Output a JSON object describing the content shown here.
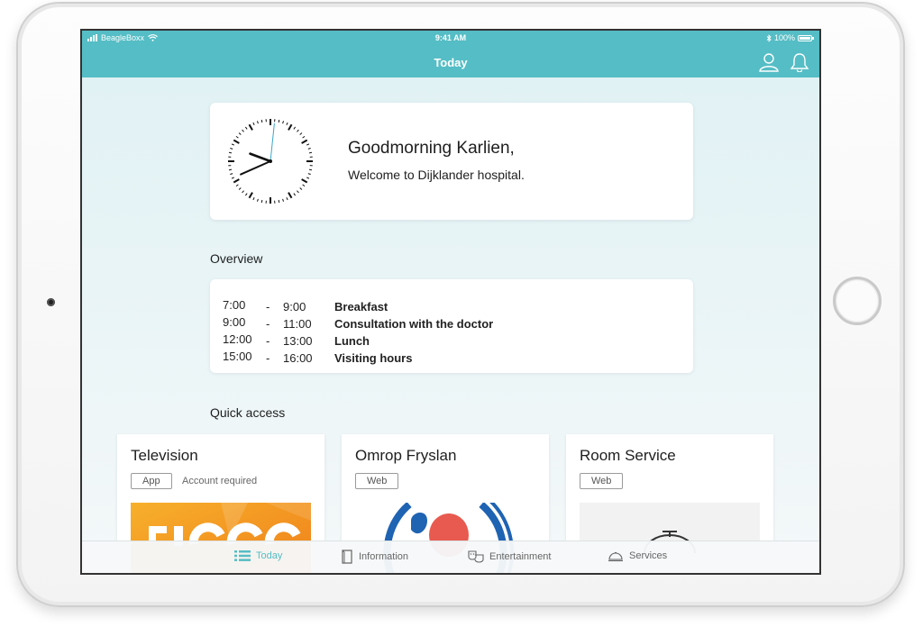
{
  "status_bar": {
    "carrier": "BeagleBoxx",
    "time": "9:41 AM",
    "bluetooth_icon": "bluetooth-icon",
    "battery": "100%"
  },
  "header": {
    "title": "Today",
    "icons": [
      "user-icon",
      "bell-icon"
    ]
  },
  "welcome": {
    "greeting": "Goodmorning Karlien,",
    "message": "Welcome to Dijklander hospital.",
    "clock": {
      "hour": 9,
      "minute": 41,
      "second": 1
    }
  },
  "overview": {
    "title": "Overview",
    "schedule": [
      {
        "start": "7:00",
        "end": "9:00",
        "event": "Breakfast"
      },
      {
        "start": "9:00",
        "end": "11:00",
        "event": "Consultation with the doctor"
      },
      {
        "start": "12:00",
        "end": "13:00",
        "event": "Lunch"
      },
      {
        "start": "15:00",
        "end": "16:00",
        "event": "Visiting hours"
      }
    ]
  },
  "quick_access": {
    "title": "Quick access",
    "items": [
      {
        "title": "Television",
        "tag": "App",
        "note": "Account required"
      },
      {
        "title": "Omrop Fryslan",
        "tag": "Web",
        "note": ""
      },
      {
        "title": "Room Service",
        "tag": "Web",
        "note": ""
      }
    ]
  },
  "tabs": [
    {
      "label": "Today",
      "icon": "list-icon",
      "active": true
    },
    {
      "label": "Information",
      "icon": "book-icon",
      "active": false
    },
    {
      "label": "Entertainment",
      "icon": "theater-masks-icon",
      "active": false
    },
    {
      "label": "Services",
      "icon": "room-service-bell-icon",
      "active": false
    }
  ],
  "colors": {
    "accent": "#55bdc5",
    "text": "#1e1e1e",
    "ziggo_orange": "#f39c12",
    "omrop_blue": "#1f63b3",
    "omrop_red": "#e85a4f"
  }
}
